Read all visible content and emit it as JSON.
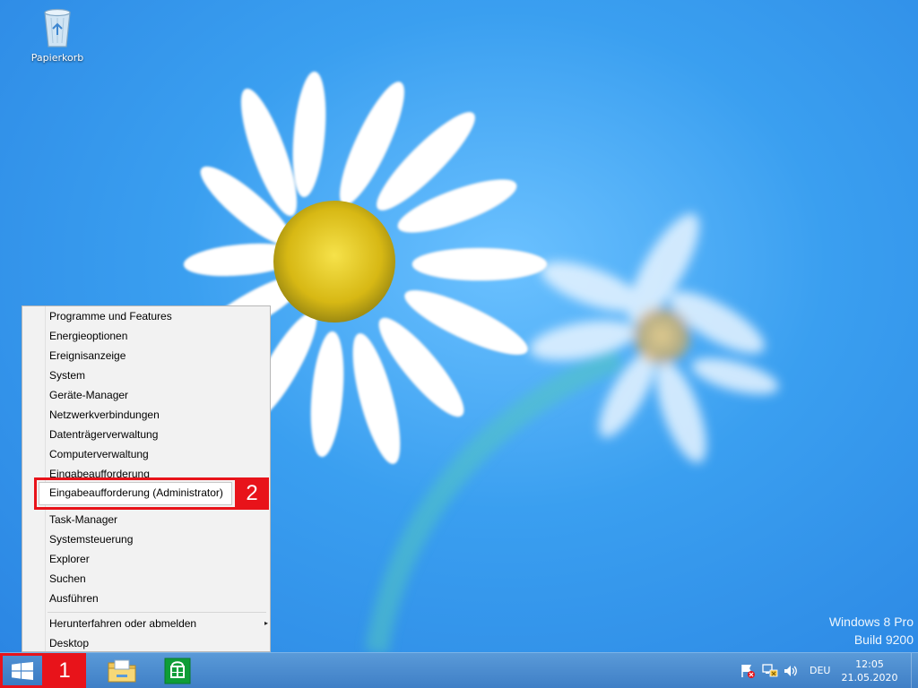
{
  "desktop": {
    "icons": [
      {
        "label": "Papierkorb",
        "icon": "recycle-bin-icon"
      }
    ],
    "watermark": {
      "line1": "Windows 8 Pro",
      "line2": "Build 9200"
    }
  },
  "context_menu": {
    "items": [
      "Programme und Features",
      "Energieoptionen",
      "Ereignisanzeige",
      "System",
      "Geräte-Manager",
      "Netzwerkverbindungen",
      "Datenträgerverwaltung",
      "Computerverwaltung",
      "Eingabeaufforderung",
      "Eingabeaufforderung (Administrator)",
      "Task-Manager",
      "Systemsteuerung",
      "Explorer",
      "Suchen",
      "Ausführen",
      "Herunterfahren oder abmelden",
      "Desktop"
    ],
    "submenu_arrow": "▸"
  },
  "annotations": {
    "step1": "1",
    "step2": "2",
    "color": "#e8131a"
  },
  "taskbar": {
    "start_icon": "windows-logo-icon",
    "pinned": [
      "file-explorer-icon",
      "store-icon"
    ],
    "tray": {
      "language": "DEU",
      "time": "12:05",
      "date": "21.05.2020"
    }
  }
}
